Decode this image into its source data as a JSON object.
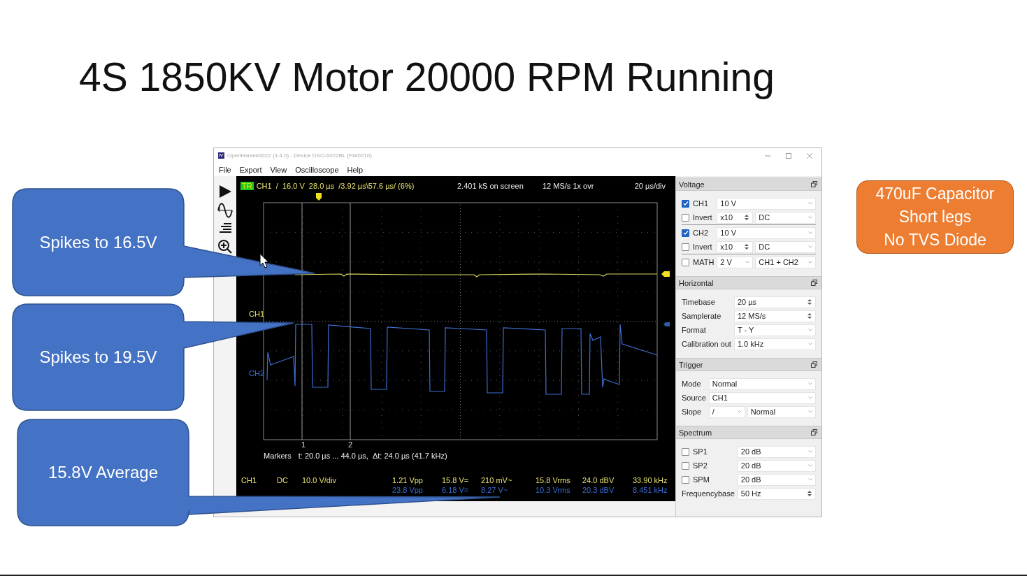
{
  "slide": {
    "title": "4S 1850KV Motor 20000 RPM Running"
  },
  "callouts": [
    {
      "text": "Spikes to 16.5V"
    },
    {
      "text": "Spikes to 19.5V"
    },
    {
      "text": "15.8V Average"
    }
  ],
  "note": {
    "lines": [
      "470uF Capacitor",
      "Short legs",
      "No TVS Diode"
    ]
  },
  "window": {
    "title": "OpenHantek6022 (3.4.0) - Device DSO-6022BL (FW0210)",
    "menu": [
      "File",
      "Export",
      "View",
      "Oscilloscope",
      "Help"
    ]
  },
  "scope": {
    "trigger_badge": "TR",
    "trigger_info": "CH1  /  16.0 V  28.0 µs  /3.92 µs\\57.6 µs/ (6%)",
    "samples": "2.401 kS on screen",
    "rate": "12 MS/s 1x ovr",
    "timebase": "20 µs/div",
    "channel_labels": [
      {
        "text": "CH1",
        "color": "#e8e070"
      },
      {
        "text": "CH2",
        "color": "#3a6fd8"
      }
    ],
    "marker_labels": [
      "1",
      "2"
    ],
    "markers": {
      "label": "Markers",
      "value": "t: 20.0 µs ... 44.0 µs,  Δt: 24.0 µs (41.7 kHz)"
    },
    "measurements": [
      {
        "channel": "CH1",
        "coupling": "DC",
        "scale": "10.0 V/div",
        "vpp": "1.21 Vpp",
        "dc": "15.8 V=",
        "ac": "210 mV~",
        "rms": "15.8 Vrms",
        "dbv": "24.0 dBV",
        "freq": "33.90 kHz",
        "color": "#e8e070"
      },
      {
        "vpp": "23.8 Vpp",
        "dc": "6.18 V=",
        "ac": "8.27 V~",
        "rms": "10.3 Vrms",
        "dbv": "20.3 dBV",
        "freq": "8.451 kHz",
        "color": "#3a6fd8"
      }
    ]
  },
  "dock": {
    "sections": [
      {
        "title": "Voltage",
        "rows": [
          {
            "kind": "check",
            "label": "CH1",
            "checked": true,
            "value": "10 V"
          },
          {
            "kind": "invert",
            "label": "Invert",
            "checked": false,
            "probe": "x10",
            "coupling": "DC"
          },
          {
            "kind": "check",
            "label": "CH2",
            "checked": true,
            "value": "10 V"
          },
          {
            "kind": "invert",
            "label": "Invert",
            "checked": false,
            "probe": "x10",
            "coupling": "DC"
          },
          {
            "kind": "check",
            "label": "MATH",
            "checked": false,
            "value": "2 V",
            "mode": "CH1 + CH2"
          }
        ]
      },
      {
        "title": "Horizontal",
        "rows": [
          {
            "kind": "spin",
            "label": "Timebase",
            "value": "20 µs"
          },
          {
            "kind": "spin",
            "label": "Samplerate",
            "value": "12 MS/s"
          },
          {
            "kind": "select",
            "label": "Format",
            "value": "T - Y"
          },
          {
            "kind": "select",
            "label": "Calibration out",
            "value": "1.0 kHz"
          }
        ]
      },
      {
        "title": "Trigger",
        "rows": [
          {
            "kind": "select",
            "label": "Mode",
            "value": "Normal"
          },
          {
            "kind": "select",
            "label": "Source",
            "value": "CH1"
          },
          {
            "kind": "pair",
            "label": "Slope",
            "value": "/",
            "mode": "Normal"
          }
        ]
      },
      {
        "title": "Spectrum",
        "rows": [
          {
            "kind": "check",
            "label": "SP1",
            "checked": false,
            "value": "20 dB"
          },
          {
            "kind": "check",
            "label": "SP2",
            "checked": false,
            "value": "20 dB"
          },
          {
            "kind": "check",
            "label": "SPM",
            "checked": false,
            "value": "20 dB"
          },
          {
            "kind": "spin",
            "label": "Frequencybase",
            "value": "50 Hz"
          }
        ]
      }
    ]
  }
}
